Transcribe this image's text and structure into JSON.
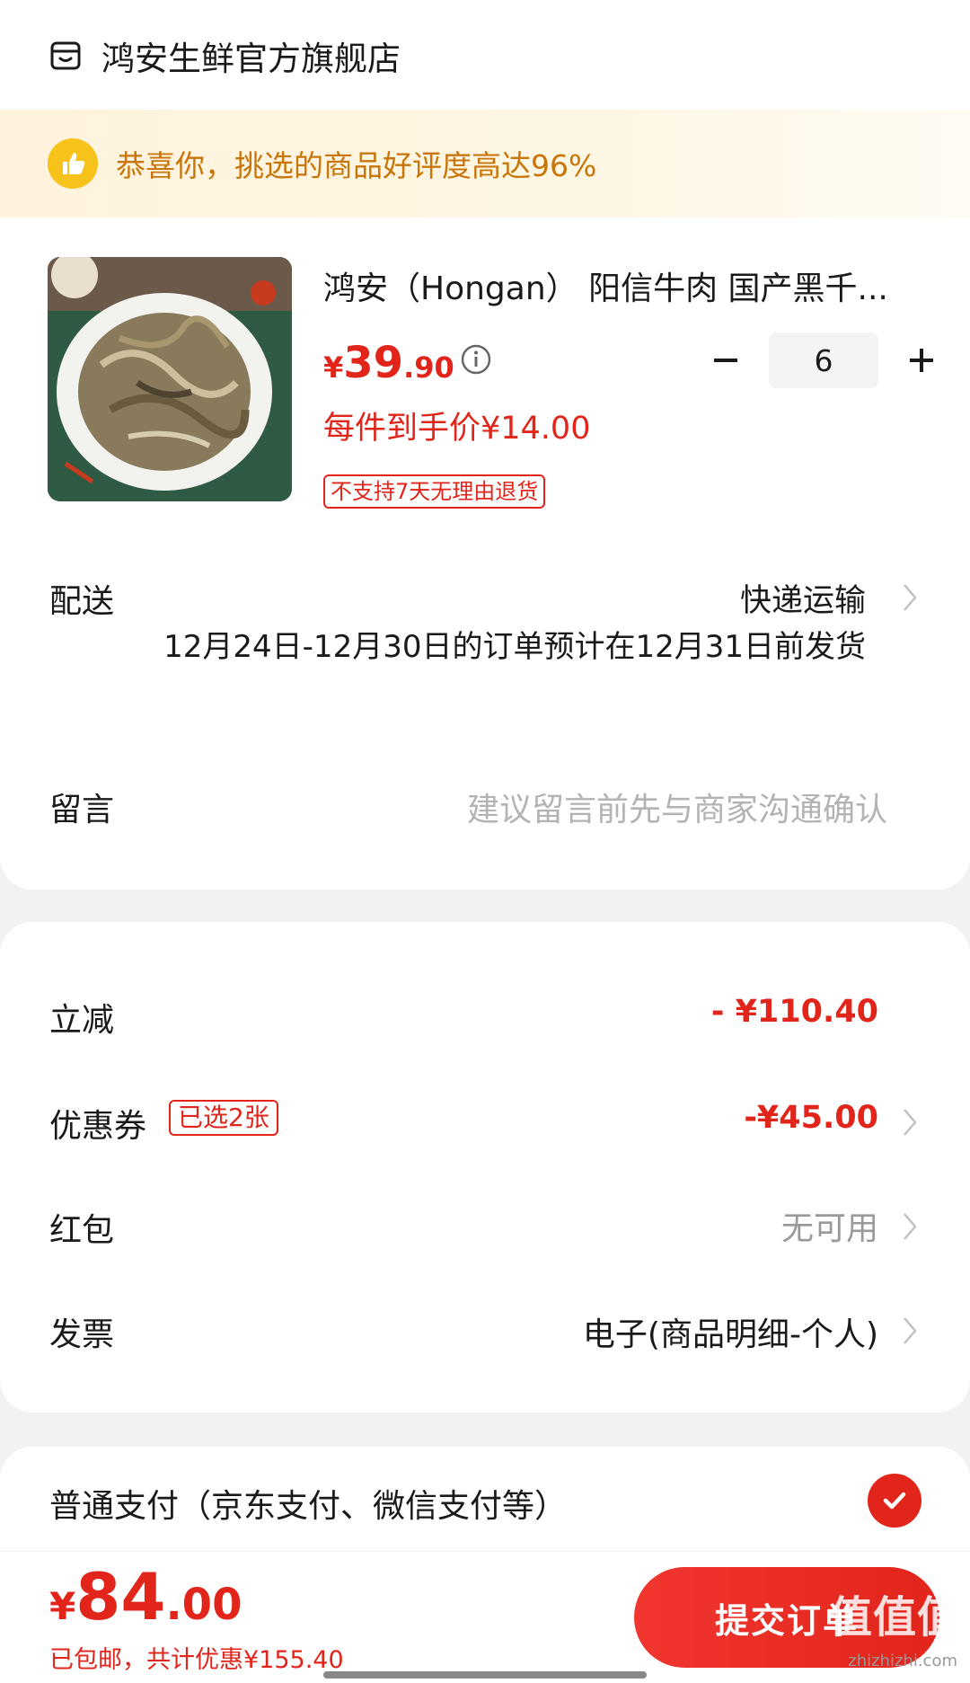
{
  "shop": {
    "name": "鸿安生鲜官方旗舰店",
    "icon": "store-icon"
  },
  "banner": {
    "text": "恭喜你，挑选的商品好评度高达96%",
    "icon": "thumbs-up-icon"
  },
  "product": {
    "title": "鸿安（Hongan） 阳信牛肉 国产黑千...",
    "price_currency": "¥",
    "price_int": "39",
    "price_dec": ".90",
    "quantity": "6",
    "unit_price_text": "每件到手价¥14.00",
    "return_tag": "不支持7天无理由退货"
  },
  "delivery": {
    "label": "配送",
    "method": "快递运输",
    "note": "12月24日-12月30日的订单预计在12月31日前发货"
  },
  "message": {
    "label": "留言",
    "placeholder": "建议留言前先与商家沟通确认"
  },
  "discounts": {
    "instant": {
      "label": "立减",
      "value": "- ¥110.40"
    },
    "coupon": {
      "label": "优惠券",
      "tag": "已选2张",
      "value": "-¥45.00"
    },
    "red_packet": {
      "label": "红包",
      "value": "无可用"
    },
    "invoice": {
      "label": "发票",
      "value": "电子(商品明细-个人)"
    }
  },
  "payment": {
    "label": "普通支付（京东支付、微信支付等）"
  },
  "footer": {
    "total_currency": "¥",
    "total_int": "84",
    "total_dec": ".00",
    "summary": "已包邮，共计优惠¥155.40",
    "submit_label": "提交订单",
    "watermark": "值值值",
    "watermark_url": "zhizhizhi.com"
  },
  "colors": {
    "accent": "#e1251b",
    "banner_text": "#c8750a",
    "banner_icon": "#f7c21a"
  }
}
